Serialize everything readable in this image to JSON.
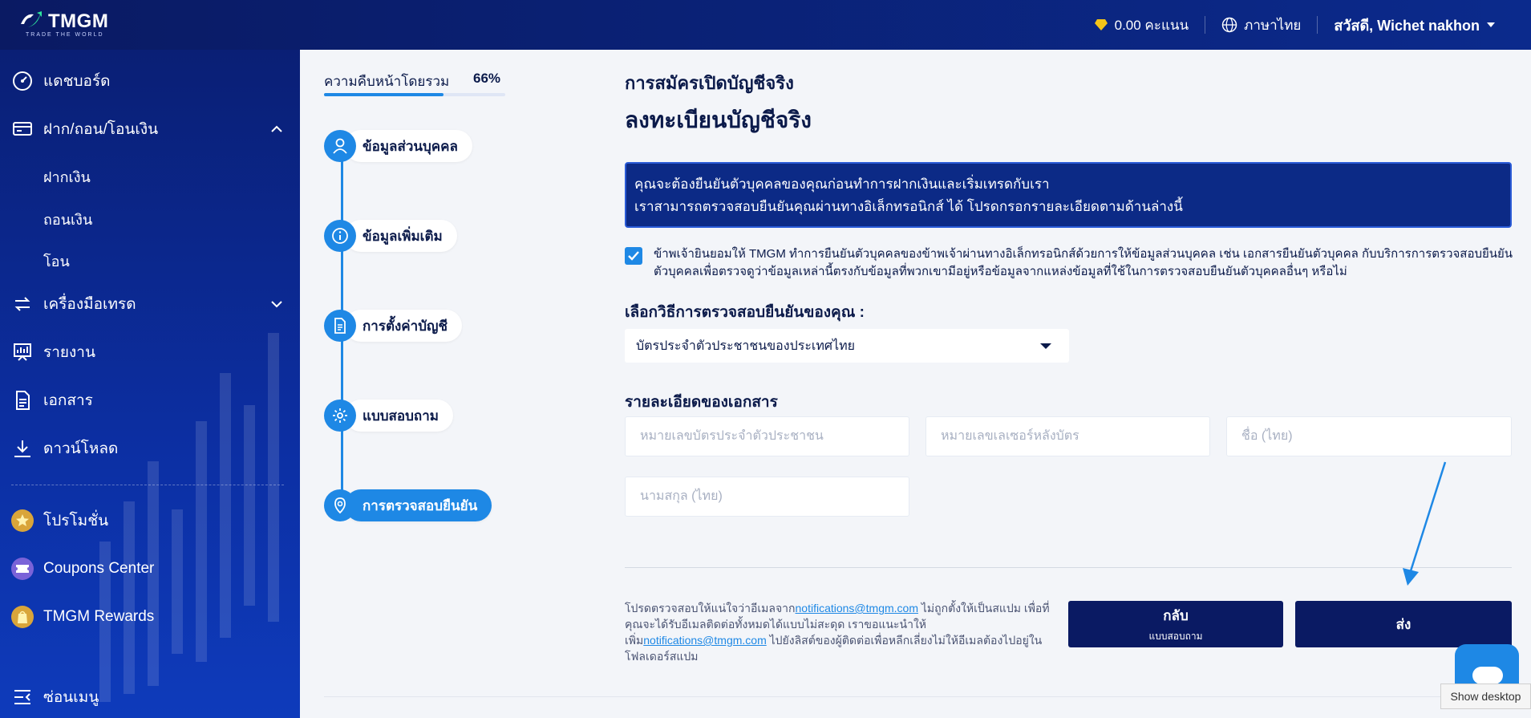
{
  "header": {
    "logo_text": "TMGM",
    "logo_tagline": "TRADE THE WORLD",
    "points": "0.00 คะแนน",
    "language": "ภาษาไทย",
    "greeting": "สวัสดี, Wichet nakhon"
  },
  "sidebar": {
    "items": [
      {
        "label": "แดชบอร์ด",
        "icon": "dashboard-icon"
      },
      {
        "label": "ฝาก/ถอน/โอนเงิน",
        "icon": "wallet-icon"
      },
      {
        "label": "ฝากเงิน"
      },
      {
        "label": "ถอนเงิน"
      },
      {
        "label": "โอน"
      },
      {
        "label": "เครื่องมือเทรด",
        "icon": "tools-icon"
      },
      {
        "label": "รายงาน",
        "icon": "report-icon"
      },
      {
        "label": "เอกสาร",
        "icon": "document-icon"
      },
      {
        "label": "ดาวน์โหลด",
        "icon": "download-icon"
      },
      {
        "label": "โปรโมชั่น",
        "icon": "promotion-icon"
      },
      {
        "label": "Coupons Center",
        "icon": "coupon-icon"
      },
      {
        "label": "TMGM Rewards",
        "icon": "rewards-icon"
      },
      {
        "label": "ซ่อนเมนู",
        "icon": "collapse-menu-icon"
      }
    ]
  },
  "progress": {
    "label": "ความคืบหน้าโดยรวม",
    "percent_text": "66%",
    "fraction": 0.66,
    "steps": [
      {
        "label": "ข้อมูลส่วนบุคคล",
        "icon": "person-icon"
      },
      {
        "label": "ข้อมูลเพิ่มเติม",
        "icon": "info-icon"
      },
      {
        "label": "การตั้งค่าบัญชี",
        "icon": "account-settings-icon"
      },
      {
        "label": "แบบสอบถาม",
        "icon": "gear-icon"
      },
      {
        "label": "การตรวจสอบยืนยัน",
        "icon": "verification-icon",
        "active": true
      }
    ]
  },
  "form": {
    "subtitle": "การสมัครเปิดบัญชีจริง",
    "title": "ลงทะเบียนบัญชีจริง",
    "notice_line1": "คุณจะต้องยืนยันตัวบุคคลของคุณก่อนทำการฝากเงินและเริ่มเทรดกับเรา",
    "notice_line2": "เราสามารถตรวจสอบยืนยันคุณผ่านทางอิเล็กทรอนิกส์ ได้ โปรดกรอกรายละเอียดตามด้านล่างนี้",
    "consent": "ข้าพเจ้ายินยอมให้ TMGM ทำการยืนยันตัวบุคคลของข้าพเจ้าผ่านทางอิเล็กทรอนิกส์ด้วยการให้ข้อมูลส่วนบุคคล เช่น เอกสารยืนยันตัวบุคคล กับบริการการตรวจสอบยืนยันตัวบุคคลเพื่อตรวจดูว่าข้อมูลเหล่านี้ตรงกับข้อมูลที่พวกเขามีอยู่หรือข้อมูลจากแหล่งข้อมูลที่ใช้ในการตรวจสอบยืนยันตัวบุคคลอื่นๆ หรือไม่",
    "method_label": "เลือกวิธีการตรวจสอบยืนยันของคุณ :",
    "method_value": "บัตรประจำตัวประชาชนของประเทศไทย",
    "docs_label": "รายละเอียดของเอกสาร",
    "id_number_placeholder": "หมายเลขบัตรประจำตัวประชาชน",
    "laser_number_placeholder": "หมายเลขเลเซอร์หลังบัตร",
    "first_name_placeholder": "ชื่อ (ไทย)",
    "last_name_placeholder": "นามสกุล (ไทย)",
    "email_note_1": "โปรดตรวจสอบให้แน่ใจว่าอีเมลจาก",
    "email_link": "notifications@tmgm.com",
    "email_note_2": " ไม่ถูกตั้งให้เป็นสแปม เพื่อที่คุณจะได้รับอีเมลติดต่อทั้งหมดได้แบบไม่สะดุด เราขอแนะนำให้เพิ่ม",
    "email_note_3": " ไปยังลิสต์ของผู้ติดต่อเพื่อหลีกเลี่ยงไม่ให้อีเมลต้องไปอยู่ในโฟลเดอร์สแปม",
    "back_label": "กลับ",
    "back_sub": "แบบสอบถาม",
    "submit_label": "ส่ง"
  },
  "overlay": {
    "show_desktop": "Show desktop"
  },
  "colors": {
    "brand_navy": "#0a1a63",
    "accent_blue": "#1e88e5",
    "gold": "#f5c518"
  }
}
